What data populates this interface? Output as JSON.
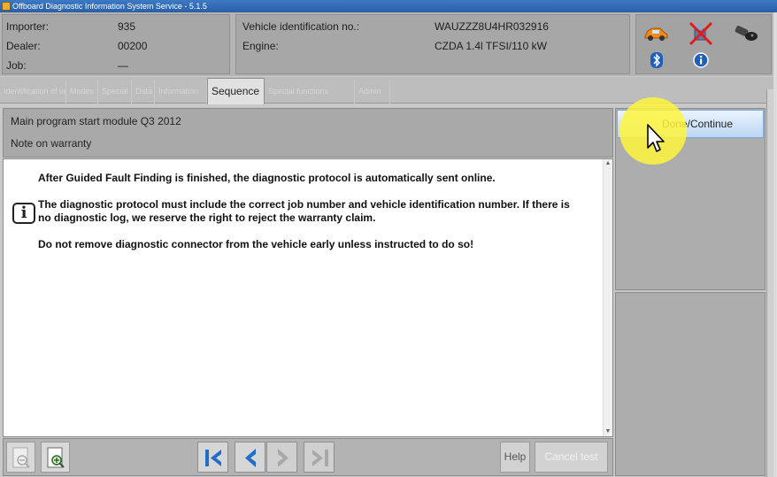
{
  "window": {
    "title": "Offboard Diagnostic Information System Service - 5.1.5"
  },
  "header": {
    "importer_label": "Importer:",
    "importer_value": "935",
    "dealer_label": "Dealer:",
    "dealer_value": "00200",
    "job_label": "Job:",
    "job_value": "—",
    "vin_label": "Vehicle identification no.:",
    "vin_value": "WAUZZZ8U4HR032916",
    "engine_label": "Engine:",
    "engine_value": "CZDA 1.4l TFSI/110 kW",
    "status_icons": [
      "car-icon",
      "disconnected-icon",
      "key-icon",
      "bluetooth-icon",
      "info-icon"
    ]
  },
  "tabs": [
    {
      "label": "Identification of vehicle"
    },
    {
      "label": "Modes"
    },
    {
      "label": "Special"
    },
    {
      "label": "Data"
    },
    {
      "label": "Information"
    },
    {
      "label": "Sequence"
    },
    {
      "label": "Special functions"
    },
    {
      "label": "Admin"
    }
  ],
  "active_tab": "Sequence",
  "program": {
    "title": "Main program start module Q3 2012",
    "subtitle": "Note on warranty"
  },
  "message": {
    "line1": "After Guided Fault Finding is finished, the diagnostic protocol is automatically sent online.",
    "line2a": "The diagnostic protocol must include the correct job number and vehicle identification number. If there is",
    "line2b": "no diagnostic log, we reserve the right to reject the warranty claim.",
    "line3": "Do not remove diagnostic connector from the vehicle early unless instructed to do so!"
  },
  "actions": {
    "done_label": "Done/Continue"
  },
  "bottombar": {
    "help_label": "Help",
    "cancel_label": "Cancel test"
  },
  "colors": {
    "accent_highlight": "#fff63c",
    "active_button": "#bcd6f2",
    "nav_arrow": "#1f6fc8"
  }
}
